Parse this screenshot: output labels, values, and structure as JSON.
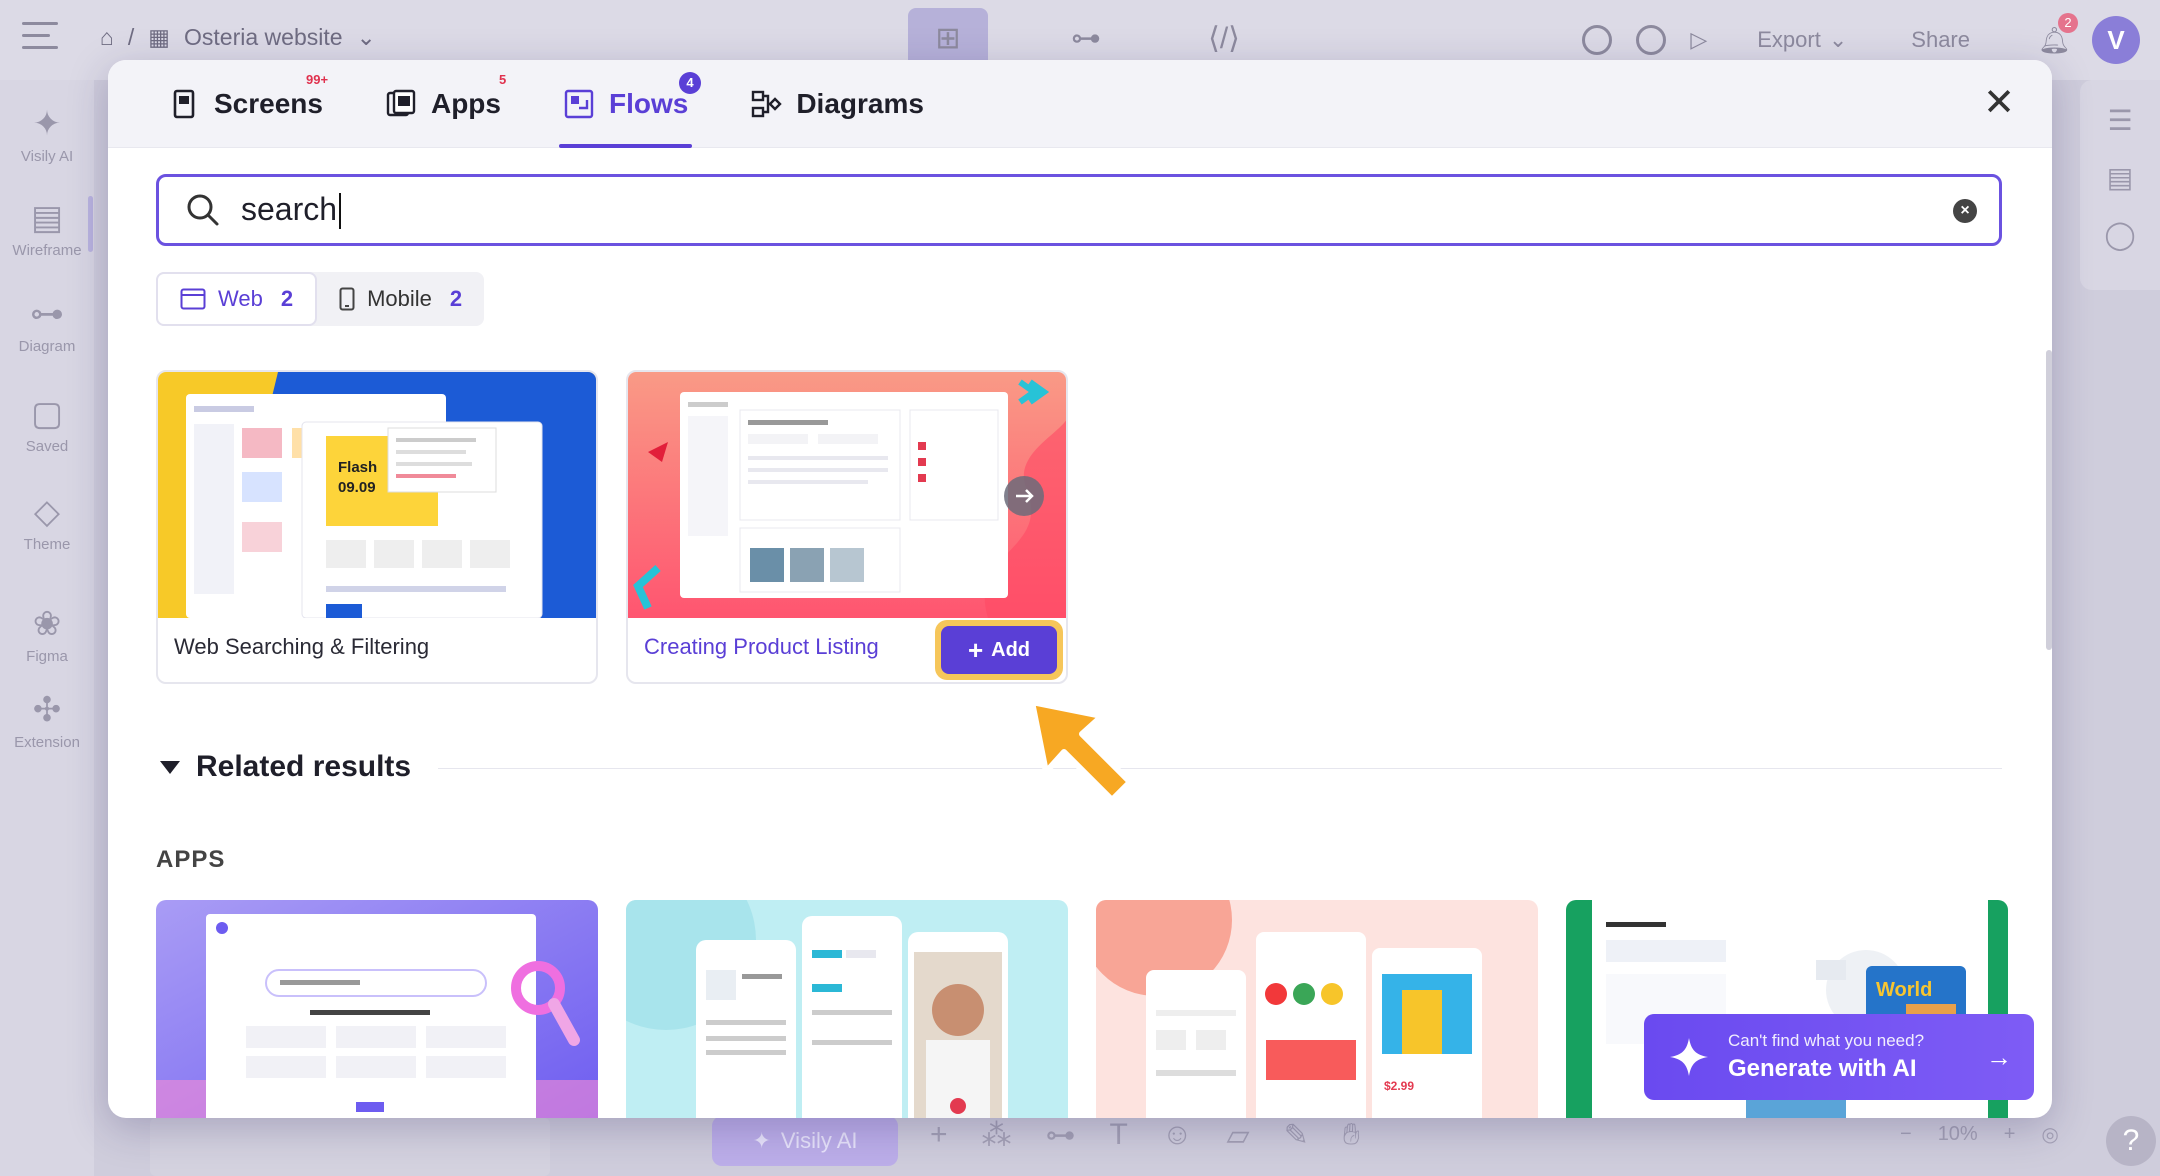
{
  "app": {
    "breadcrumb_project": "Osteria website",
    "export_label": "Export",
    "share_label": "Share",
    "notification_count": "2",
    "avatar_letter": "V"
  },
  "left_nav": [
    {
      "label": "Visily AI",
      "icon": "sparkle-icon"
    },
    {
      "label": "Wireframe",
      "icon": "wireframe-icon"
    },
    {
      "label": "Diagram",
      "icon": "diagram-icon"
    },
    {
      "label": "Saved",
      "icon": "saved-icon"
    },
    {
      "label": "Theme",
      "icon": "theme-icon"
    },
    {
      "label": "Figma",
      "icon": "figma-icon"
    },
    {
      "label": "Extension",
      "icon": "extension-icon"
    }
  ],
  "bottom": {
    "ai_label": "Visily AI",
    "zoom": "10%"
  },
  "modal": {
    "tabs": [
      {
        "label": "Screens",
        "badge": "99+"
      },
      {
        "label": "Apps",
        "badge": "5"
      },
      {
        "label": "Flows",
        "badge": "4"
      },
      {
        "label": "Diagrams",
        "badge": ""
      }
    ],
    "search_value": "search",
    "filters": [
      {
        "label": "Web",
        "count": "2"
      },
      {
        "label": "Mobile",
        "count": "2"
      }
    ],
    "results": [
      {
        "title": "Web Searching & Filtering"
      },
      {
        "title": "Creating Product Listing"
      }
    ],
    "add_label": "Add",
    "related_title": "Related results",
    "apps_label": "APPS",
    "ai_banner": {
      "line1": "Can't find what you need?",
      "line2": "Generate with AI"
    }
  },
  "colors": {
    "accent": "#5a3fd6",
    "highlight": "#f6c65a",
    "badge_red": "#e0314e"
  }
}
